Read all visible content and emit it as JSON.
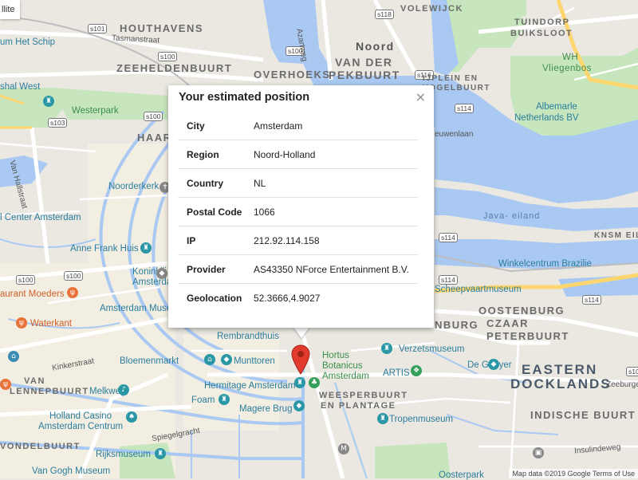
{
  "map_controls": {
    "satellite_label": "llite"
  },
  "attribution": "Map data ©2019 Google   Terms of Use",
  "info_window": {
    "title": "Your estimated position",
    "close_symbol": "×",
    "rows": [
      {
        "key": "City",
        "value": "Amsterdam"
      },
      {
        "key": "Region",
        "value": "Noord-Holland"
      },
      {
        "key": "Country",
        "value": "NL"
      },
      {
        "key": "Postal Code",
        "value": "1066"
      },
      {
        "key": "IP",
        "value": "212.92.114.158"
      },
      {
        "key": "Provider",
        "value": "AS43350 NForce Entertainment B.V."
      },
      {
        "key": "Geolocation",
        "value": "52.3666,4.9027"
      }
    ]
  },
  "map_labels": {
    "districts": {
      "houthavens": "HOUTHAVENS",
      "zeeheldenbuurt": "ZEEHELDENBUURT",
      "overhoeks": "OVERHOEKS",
      "noord": "Noord",
      "van_der_pekbuurt_1": "VAN DER",
      "van_der_pekbuurt_2": "PEKBUURT",
      "volewijck": "VOLEWIJCK",
      "tuindorp_1": "TUINDORP",
      "tuindorp_2": "BUIKSLOOT",
      "ijplein_1": "IJPLEIN EN",
      "ijplein_2": "VOGELBUURT",
      "haarl": "HAARL",
      "oostenburg": "OOSTENBURG",
      "czaar_1": "CZAAR",
      "czaar_2": "PETERBUURT",
      "eastern_1": "EASTERN",
      "eastern_2": "DOCKLANDS",
      "indische": "INDISCHE BUURT",
      "weesperbuurt_1": "WEESPERBUURT",
      "weesperbuurt_2": "EN PLANTAGE",
      "vondelbuurt": "VONDELBUURT",
      "van_lennep_1": "VAN",
      "van_lennep_2": "LENNEPBUURT",
      "knsm": "KNSM EIL",
      "java": "Java- eiland",
      "nburg": "NBURG",
      "wh_1": "WH",
      "wh_2": "Vliegenbos"
    },
    "pois": {
      "het_schip": "um Het Schip",
      "westerpark": "Westerpark",
      "noorderkerk": "Noorderkerk",
      "centraal": "l Center Amsterdam",
      "anne_frank": "Anne Frank Huis",
      "koninklijk_1": "Koninklij",
      "koninklijk_2": "Amsterda",
      "restaurant": "aurant Moeders",
      "waterkant": "Waterkant",
      "amsterdam_museum": "Amsterdam Museum",
      "rembrandthuis": "Rembrandthuis",
      "bloemenmarkt": "Bloemenmarkt",
      "munttoren": "Munttoren",
      "hermitage": "Hermitage Amsterdam",
      "hortus_1": "Hortus",
      "hortus_2": "Botanicus",
      "hortus_3": "Amsterdam",
      "artis": "ARTIS",
      "verzetsmuseum": "Verzetsmuseum",
      "de_gooyer": "De Gooyer",
      "foam": "Foam",
      "magere_brug": "Magere Brug",
      "melkweg": "Melkweg",
      "holland_casino_1": "Holland Casino",
      "holland_casino_2": "Amsterdam Centrum",
      "rijksmuseum": "Rijksmuseum",
      "van_gogh": "Van Gogh Museum",
      "tropenmuseum": "Tropenmuseum",
      "scheepvaart": "Scheepvaartmuseum",
      "winkelcentrum": "Winkelcentrum Brazilie",
      "albemarle_1": "Albemarle",
      "albemarle_2": "Netherlands BV",
      "shal_west": "shal West",
      "oosterpark": "Oosterpark"
    },
    "streets": {
      "tasmanstraat": "Tasmanstraat",
      "van_hallstraat": "Van Hallstraat",
      "kinkerstraat": "Kinkerstraat",
      "spiegelgracht": "Spiegelgracht",
      "insulindeweg": "Insulindeweg",
      "zeeburger": "Zeeburger",
      "ijzeewuwenlaan": "euwenlaan",
      "azartweg": "Azartweg"
    },
    "shields": [
      "s101",
      "s100",
      "s100",
      "s118",
      "s116",
      "s103",
      "s100",
      "s100",
      "s100",
      "s114",
      "s114",
      "s114",
      "s114",
      "s102"
    ]
  },
  "colors": {
    "water": "#a9c9f2",
    "park": "#c7e6bd",
    "land": "#ebe8e2",
    "road": "#ffffff",
    "highway": "#fdd66f",
    "marker": "#e23b2e"
  }
}
